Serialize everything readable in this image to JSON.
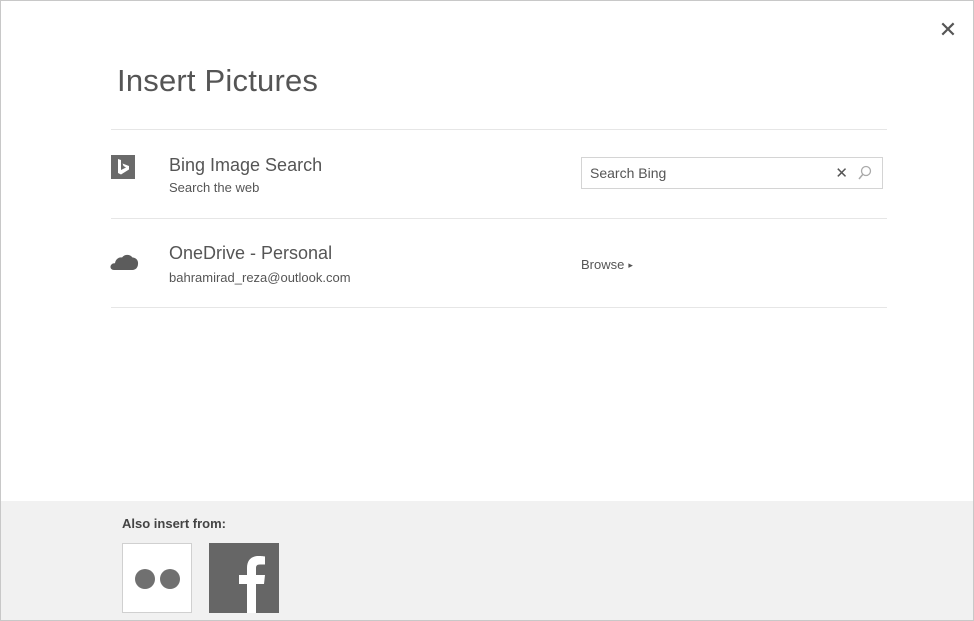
{
  "dialog": {
    "title": "Insert Pictures",
    "close_glyph": "✕"
  },
  "sources": [
    {
      "name": "Bing Image Search",
      "sub": "Search the web",
      "icon": "bing-icon",
      "search": {
        "placeholder": "Search Bing",
        "clear_glyph": "✕"
      }
    },
    {
      "name": "OneDrive - Personal",
      "sub": "bahramirad_reza@outlook.com",
      "icon": "cloud-icon",
      "action_label": "Browse",
      "action_arrow": "▸"
    }
  ],
  "footer": {
    "label": "Also insert from:",
    "services": [
      {
        "icon": "flickr-icon"
      },
      {
        "icon": "facebook-icon"
      }
    ]
  },
  "colors": {
    "footer_bg": "#f1f1f1",
    "icon_gray": "#666666",
    "text": "#555555"
  }
}
